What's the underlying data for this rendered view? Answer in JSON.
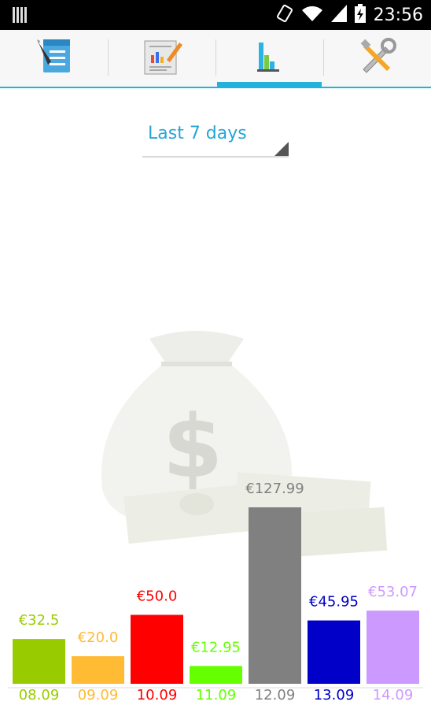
{
  "status_bar": {
    "time": "23:56",
    "icons": [
      "notification-bars-icon",
      "rotate-icon",
      "wifi-icon",
      "signal-icon",
      "battery-icon"
    ]
  },
  "tabs": [
    {
      "name": "tasks-tab",
      "icon": "checklist-icon",
      "active": false
    },
    {
      "name": "reports-tab",
      "icon": "report-chart-icon",
      "active": false
    },
    {
      "name": "statistics-tab",
      "icon": "bar-chart-icon",
      "active": true
    },
    {
      "name": "settings-tab",
      "icon": "tools-icon",
      "active": false
    }
  ],
  "period_selector": {
    "value": "Last 7 days"
  },
  "colors": {
    "accent": "#26b1dd",
    "spinner_text": "#27a6d7"
  },
  "chart_data": {
    "type": "bar",
    "categories": [
      "08.09",
      "09.09",
      "10.09",
      "11.09",
      "12.09",
      "13.09",
      "14.09"
    ],
    "values": [
      32.5,
      20.0,
      50.0,
      12.95,
      127.99,
      45.95,
      53.07
    ],
    "value_labels": [
      "€32.5",
      "€20.0",
      "€50.0",
      "€12.95",
      "€127.99",
      "€45.95",
      "€53.07"
    ],
    "colors": [
      "#99cc00",
      "#ffbb33",
      "#ff0000",
      "#66ff00",
      "#808080",
      "#0000c8",
      "#cc99ff"
    ],
    "ylim": [
      0,
      127.99
    ],
    "grid": false
  }
}
